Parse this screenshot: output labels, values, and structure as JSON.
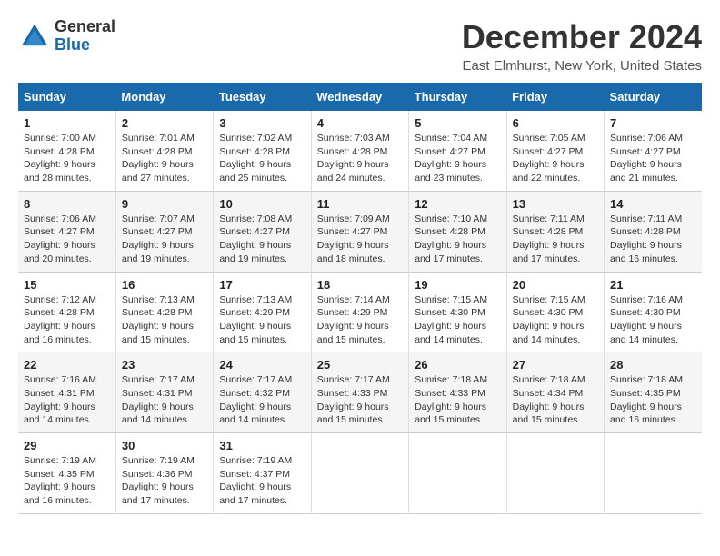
{
  "logo": {
    "line1": "General",
    "line2": "Blue"
  },
  "title": "December 2024",
  "subtitle": "East Elmhurst, New York, United States",
  "days_header": [
    "Sunday",
    "Monday",
    "Tuesday",
    "Wednesday",
    "Thursday",
    "Friday",
    "Saturday"
  ],
  "weeks": [
    [
      {
        "day": "1",
        "info": "Sunrise: 7:00 AM\nSunset: 4:28 PM\nDaylight: 9 hours\nand 28 minutes."
      },
      {
        "day": "2",
        "info": "Sunrise: 7:01 AM\nSunset: 4:28 PM\nDaylight: 9 hours\nand 27 minutes."
      },
      {
        "day": "3",
        "info": "Sunrise: 7:02 AM\nSunset: 4:28 PM\nDaylight: 9 hours\nand 25 minutes."
      },
      {
        "day": "4",
        "info": "Sunrise: 7:03 AM\nSunset: 4:28 PM\nDaylight: 9 hours\nand 24 minutes."
      },
      {
        "day": "5",
        "info": "Sunrise: 7:04 AM\nSunset: 4:27 PM\nDaylight: 9 hours\nand 23 minutes."
      },
      {
        "day": "6",
        "info": "Sunrise: 7:05 AM\nSunset: 4:27 PM\nDaylight: 9 hours\nand 22 minutes."
      },
      {
        "day": "7",
        "info": "Sunrise: 7:06 AM\nSunset: 4:27 PM\nDaylight: 9 hours\nand 21 minutes."
      }
    ],
    [
      {
        "day": "8",
        "info": "Sunrise: 7:06 AM\nSunset: 4:27 PM\nDaylight: 9 hours\nand 20 minutes."
      },
      {
        "day": "9",
        "info": "Sunrise: 7:07 AM\nSunset: 4:27 PM\nDaylight: 9 hours\nand 19 minutes."
      },
      {
        "day": "10",
        "info": "Sunrise: 7:08 AM\nSunset: 4:27 PM\nDaylight: 9 hours\nand 19 minutes."
      },
      {
        "day": "11",
        "info": "Sunrise: 7:09 AM\nSunset: 4:27 PM\nDaylight: 9 hours\nand 18 minutes."
      },
      {
        "day": "12",
        "info": "Sunrise: 7:10 AM\nSunset: 4:28 PM\nDaylight: 9 hours\nand 17 minutes."
      },
      {
        "day": "13",
        "info": "Sunrise: 7:11 AM\nSunset: 4:28 PM\nDaylight: 9 hours\nand 17 minutes."
      },
      {
        "day": "14",
        "info": "Sunrise: 7:11 AM\nSunset: 4:28 PM\nDaylight: 9 hours\nand 16 minutes."
      }
    ],
    [
      {
        "day": "15",
        "info": "Sunrise: 7:12 AM\nSunset: 4:28 PM\nDaylight: 9 hours\nand 16 minutes."
      },
      {
        "day": "16",
        "info": "Sunrise: 7:13 AM\nSunset: 4:28 PM\nDaylight: 9 hours\nand 15 minutes."
      },
      {
        "day": "17",
        "info": "Sunrise: 7:13 AM\nSunset: 4:29 PM\nDaylight: 9 hours\nand 15 minutes."
      },
      {
        "day": "18",
        "info": "Sunrise: 7:14 AM\nSunset: 4:29 PM\nDaylight: 9 hours\nand 15 minutes."
      },
      {
        "day": "19",
        "info": "Sunrise: 7:15 AM\nSunset: 4:30 PM\nDaylight: 9 hours\nand 14 minutes."
      },
      {
        "day": "20",
        "info": "Sunrise: 7:15 AM\nSunset: 4:30 PM\nDaylight: 9 hours\nand 14 minutes."
      },
      {
        "day": "21",
        "info": "Sunrise: 7:16 AM\nSunset: 4:30 PM\nDaylight: 9 hours\nand 14 minutes."
      }
    ],
    [
      {
        "day": "22",
        "info": "Sunrise: 7:16 AM\nSunset: 4:31 PM\nDaylight: 9 hours\nand 14 minutes."
      },
      {
        "day": "23",
        "info": "Sunrise: 7:17 AM\nSunset: 4:31 PM\nDaylight: 9 hours\nand 14 minutes."
      },
      {
        "day": "24",
        "info": "Sunrise: 7:17 AM\nSunset: 4:32 PM\nDaylight: 9 hours\nand 14 minutes."
      },
      {
        "day": "25",
        "info": "Sunrise: 7:17 AM\nSunset: 4:33 PM\nDaylight: 9 hours\nand 15 minutes."
      },
      {
        "day": "26",
        "info": "Sunrise: 7:18 AM\nSunset: 4:33 PM\nDaylight: 9 hours\nand 15 minutes."
      },
      {
        "day": "27",
        "info": "Sunrise: 7:18 AM\nSunset: 4:34 PM\nDaylight: 9 hours\nand 15 minutes."
      },
      {
        "day": "28",
        "info": "Sunrise: 7:18 AM\nSunset: 4:35 PM\nDaylight: 9 hours\nand 16 minutes."
      }
    ],
    [
      {
        "day": "29",
        "info": "Sunrise: 7:19 AM\nSunset: 4:35 PM\nDaylight: 9 hours\nand 16 minutes."
      },
      {
        "day": "30",
        "info": "Sunrise: 7:19 AM\nSunset: 4:36 PM\nDaylight: 9 hours\nand 17 minutes."
      },
      {
        "day": "31",
        "info": "Sunrise: 7:19 AM\nSunset: 4:37 PM\nDaylight: 9 hours\nand 17 minutes."
      },
      null,
      null,
      null,
      null
    ]
  ]
}
